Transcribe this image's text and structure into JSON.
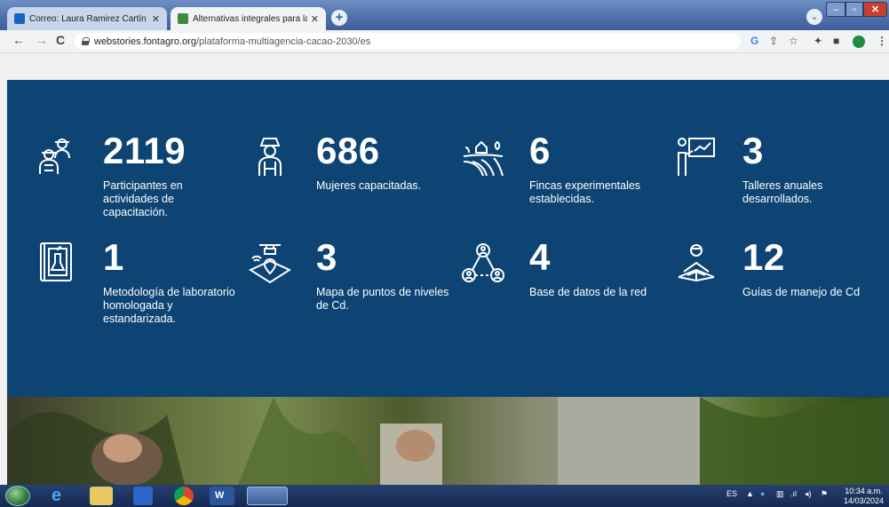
{
  "browser": {
    "tabs": [
      {
        "title": "Correo: Laura Ramirez Cartín - O",
        "favicon_color": "#1565c0"
      },
      {
        "title": "Alternativas integrales para la re",
        "favicon_color": "#3d8b3d"
      }
    ],
    "url_host": "webstories.fontagro.org",
    "url_path": "/plataforma-multiagencia-cacao-2030/es"
  },
  "stats": [
    {
      "number": "2119",
      "label": "Participantes en actividades de capacitación.",
      "icon": "farmers-group-icon"
    },
    {
      "number": "686",
      "label": "Mujeres capacitadas.",
      "icon": "farmer-woman-icon"
    },
    {
      "number": "6",
      "label": "Fincas experimentales establecidas.",
      "icon": "farm-field-icon"
    },
    {
      "number": "3",
      "label": "Talleres anuales desarrollados.",
      "icon": "presenter-board-icon"
    },
    {
      "number": "1",
      "label": "Metodología de laboratorio homologada y estandarizada.",
      "icon": "lab-book-icon"
    },
    {
      "number": "3",
      "label": "Mapa de puntos de niveles de Cd.",
      "icon": "drone-map-icon"
    },
    {
      "number": "4",
      "label": "Base de datos de la red",
      "icon": "network-nodes-icon"
    },
    {
      "number": "12",
      "label": "Guías de manejo de Cd",
      "icon": "reader-book-icon"
    }
  ],
  "taskbar": {
    "language": "ES",
    "time": "10:34 a.m.",
    "date": "14/03/2024"
  },
  "colors": {
    "stats_bg": "#0e4473",
    "text": "#ffffff"
  }
}
